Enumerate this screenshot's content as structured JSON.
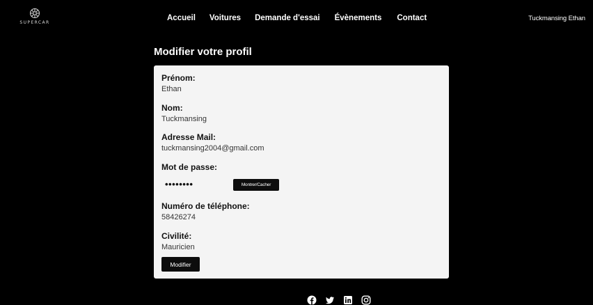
{
  "brand": {
    "logo_text": "SUPERCAR"
  },
  "nav": {
    "links": [
      "Accueil",
      "Voitures",
      "Demande d'essai",
      "Évènements",
      "Contact"
    ],
    "user_name": "Tuckmansing Ethan"
  },
  "page_title": "Modifier votre profil",
  "profile": {
    "prenom": {
      "label": "Prénom:",
      "value": "Ethan"
    },
    "nom": {
      "label": "Nom:",
      "value": "Tuckmansing"
    },
    "email": {
      "label": "Adresse Mail:",
      "value": "tuckmansing2004@gmail.com"
    },
    "password": {
      "label": "Mot de passe:",
      "masked": "••••••••",
      "toggle_label": "Montrer/Cacher"
    },
    "phone": {
      "label": "Numéro de téléphone:",
      "value": "58426274"
    },
    "civilite": {
      "label": "Civilité:",
      "value": "Mauricien"
    },
    "submit_label": "Modifier"
  },
  "footer": {
    "social_icons": [
      "facebook-icon",
      "twitter-icon",
      "linkedin-icon",
      "instagram-icon"
    ]
  },
  "colors": {
    "background": "#000000",
    "card": "#f4f4f4",
    "button": "#0d0d0d",
    "text_light": "#ffffff"
  }
}
